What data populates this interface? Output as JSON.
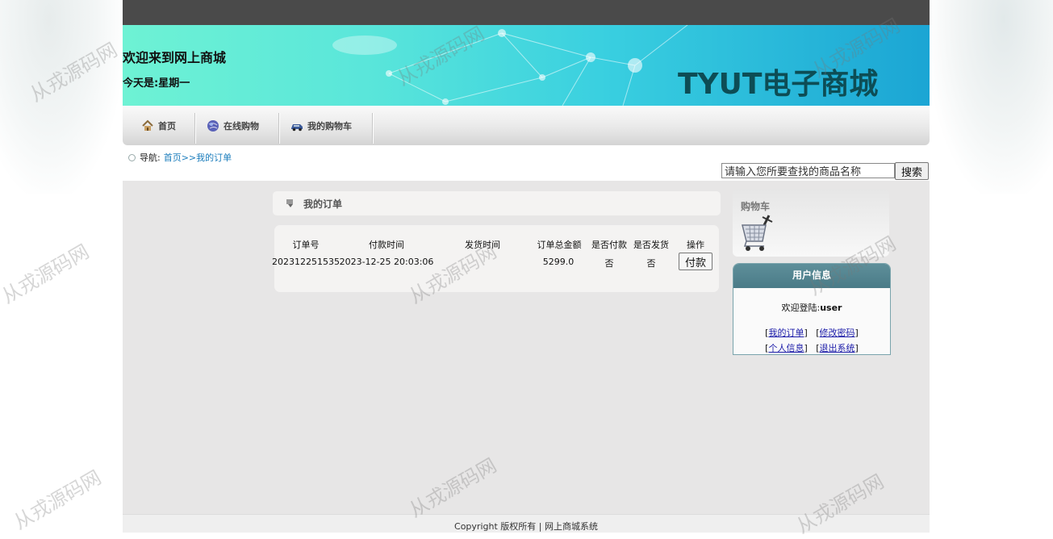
{
  "header": {
    "welcome": "欢迎来到网上商城",
    "today_label": "今天是:",
    "weekday": "星期一",
    "logo": "TYUT电子商城"
  },
  "nav": {
    "items": [
      {
        "label": "首页",
        "icon": "home-icon"
      },
      {
        "label": "在线购物",
        "icon": "globe-icon"
      },
      {
        "label": "我的购物车",
        "icon": "car-icon"
      }
    ]
  },
  "breadcrumb": {
    "prefix": "导航:",
    "home": "首页",
    "current": ">>我的订单"
  },
  "search": {
    "value": "请输入您所要查找的商品名称",
    "button": "搜索"
  },
  "orders": {
    "title": "我的订单",
    "columns": [
      "订单号",
      "付款时间",
      "发货时间",
      "订单总金额",
      "是否付款",
      "是否发货",
      "操作"
    ],
    "rows": [
      {
        "order_no": "202312251535",
        "pay_time": "2023-12-25 20:03:06",
        "ship_time": "",
        "total": "5299.0",
        "paid": "否",
        "shipped": "否",
        "action": "付款"
      }
    ]
  },
  "sidebar": {
    "cart_title": "购物车",
    "user_title": "用户信息",
    "welcome_prefix": "欢迎登陆:",
    "username": "user",
    "links": [
      "我的订单",
      "修改密码",
      "个人信息",
      "退出系统"
    ]
  },
  "footer": {
    "text": "Copyright 版权所有 | 网上商城系统"
  },
  "watermark": "从戎源码网",
  "colors": {
    "topbar": "#4a4a4a",
    "logo": "#0d4d55",
    "link": "#1b7dbc",
    "user_header": "#5e8f9a",
    "main_bg": "#e7e6e6"
  }
}
